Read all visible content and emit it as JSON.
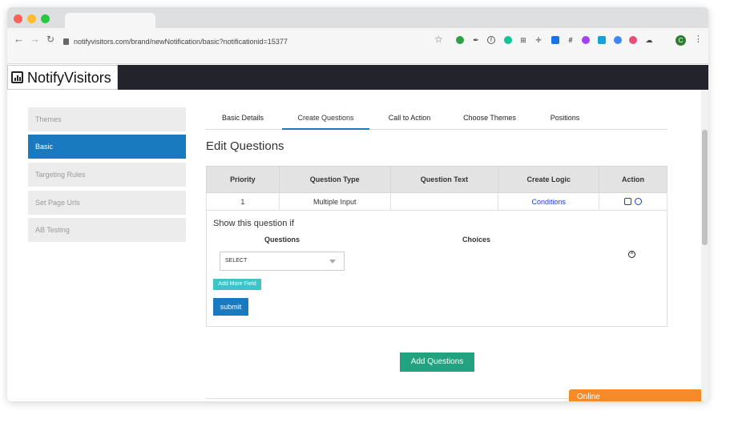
{
  "browser": {
    "url": "notifyvisitors.com/brand/newNotification/basic?notificationid=15377",
    "profile_initial": "C",
    "extension_icons": [
      "green-shield",
      "dropper",
      "fx",
      "grammarly",
      "crop",
      "move",
      "pen",
      "hash",
      "palette",
      "screenshot",
      "chrome",
      "colorpicker",
      "cloud"
    ]
  },
  "header": {
    "logo_text": "NotifyVisitors"
  },
  "sidebar": {
    "items": [
      {
        "label": "Themes",
        "active": false
      },
      {
        "label": "Basic",
        "active": true
      },
      {
        "label": "Targeting Rules",
        "active": false
      },
      {
        "label": "Set Page Urls",
        "active": false
      },
      {
        "label": "AB Testing",
        "active": false
      }
    ]
  },
  "tabs": [
    {
      "label": "Basic Details",
      "active": false
    },
    {
      "label": "Create Questions",
      "active": true
    },
    {
      "label": "Call to Action",
      "active": false
    },
    {
      "label": "Choose Themes",
      "active": false
    },
    {
      "label": "Positions",
      "active": false
    }
  ],
  "main": {
    "title": "Edit Questions",
    "table": {
      "headers": [
        "Priority",
        "Question Type",
        "Question Text",
        "Create Logic",
        "Action"
      ],
      "rows": [
        {
          "priority": "1",
          "type": "Multiple Input",
          "text": "",
          "logic": "Conditions"
        }
      ]
    },
    "logic": {
      "heading": "Show this question if",
      "questions_label": "Questions",
      "choices_label": "Choices",
      "select_value": "SELECT",
      "add_more_label": "Add More Field",
      "submit_label": "submit"
    },
    "add_questions_label": "Add Questions"
  },
  "chat": {
    "status": "Online"
  },
  "colors": {
    "accent": "#1a7ac0",
    "success": "#22a27e",
    "chat": "#f58a2a",
    "header": "#22232b"
  }
}
